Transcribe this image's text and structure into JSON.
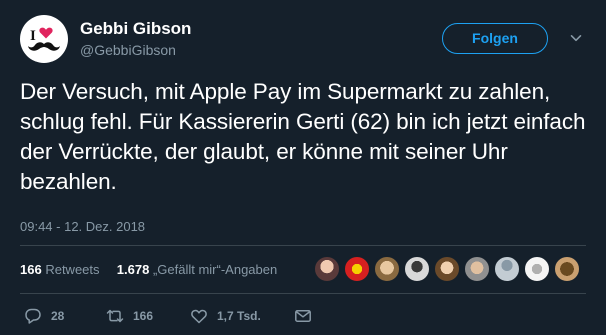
{
  "user": {
    "display_name": "Gebbi Gibson",
    "handle": "@GebbiGibson",
    "avatar_icon": "i-love-mustache-logo"
  },
  "follow_label": "Folgen",
  "tweet_text": "Der Versuch, mit Apple Pay im Supermarkt zu zahlen, schlug fehl. Für Kassiererin Gerti (62) bin ich jetzt einfach der Verrückte, der glaubt, er könne mit seiner Uhr bezahlen.",
  "timestamp": "09:44 - 12. Dez. 2018",
  "stats": {
    "retweets_count": "166",
    "retweets_label": "Retweets",
    "likes_count": "1.678",
    "likes_label": "„Gefällt mir“-Angaben"
  },
  "actions": {
    "reply_count": "28",
    "retweet_count": "166",
    "like_count": "1,7 Tsd."
  },
  "colors": {
    "background": "#15202b",
    "accent": "#1da1f2",
    "muted": "#8899a6",
    "divider": "#38444d"
  }
}
